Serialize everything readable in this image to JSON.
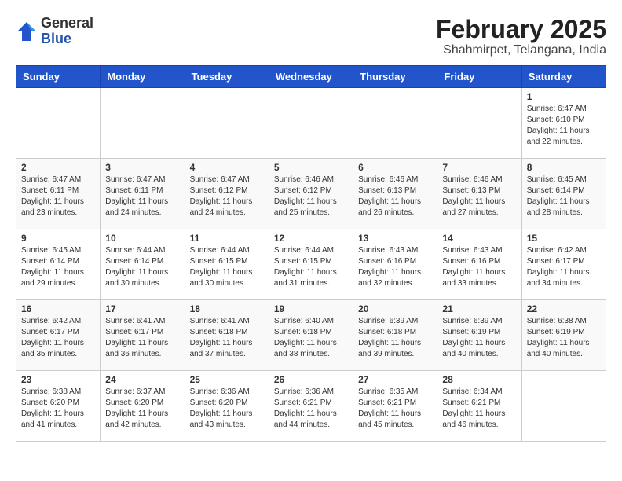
{
  "logo": {
    "general": "General",
    "blue": "Blue"
  },
  "title": "February 2025",
  "subtitle": "Shahmirpet, Telangana, India",
  "days_of_week": [
    "Sunday",
    "Monday",
    "Tuesday",
    "Wednesday",
    "Thursday",
    "Friday",
    "Saturday"
  ],
  "weeks": [
    [
      {
        "day": "",
        "detail": ""
      },
      {
        "day": "",
        "detail": ""
      },
      {
        "day": "",
        "detail": ""
      },
      {
        "day": "",
        "detail": ""
      },
      {
        "day": "",
        "detail": ""
      },
      {
        "day": "",
        "detail": ""
      },
      {
        "day": "1",
        "detail": "Sunrise: 6:47 AM\nSunset: 6:10 PM\nDaylight: 11 hours and 22 minutes."
      }
    ],
    [
      {
        "day": "2",
        "detail": "Sunrise: 6:47 AM\nSunset: 6:11 PM\nDaylight: 11 hours and 23 minutes."
      },
      {
        "day": "3",
        "detail": "Sunrise: 6:47 AM\nSunset: 6:11 PM\nDaylight: 11 hours and 24 minutes."
      },
      {
        "day": "4",
        "detail": "Sunrise: 6:47 AM\nSunset: 6:12 PM\nDaylight: 11 hours and 24 minutes."
      },
      {
        "day": "5",
        "detail": "Sunrise: 6:46 AM\nSunset: 6:12 PM\nDaylight: 11 hours and 25 minutes."
      },
      {
        "day": "6",
        "detail": "Sunrise: 6:46 AM\nSunset: 6:13 PM\nDaylight: 11 hours and 26 minutes."
      },
      {
        "day": "7",
        "detail": "Sunrise: 6:46 AM\nSunset: 6:13 PM\nDaylight: 11 hours and 27 minutes."
      },
      {
        "day": "8",
        "detail": "Sunrise: 6:45 AM\nSunset: 6:14 PM\nDaylight: 11 hours and 28 minutes."
      }
    ],
    [
      {
        "day": "9",
        "detail": "Sunrise: 6:45 AM\nSunset: 6:14 PM\nDaylight: 11 hours and 29 minutes."
      },
      {
        "day": "10",
        "detail": "Sunrise: 6:44 AM\nSunset: 6:14 PM\nDaylight: 11 hours and 30 minutes."
      },
      {
        "day": "11",
        "detail": "Sunrise: 6:44 AM\nSunset: 6:15 PM\nDaylight: 11 hours and 30 minutes."
      },
      {
        "day": "12",
        "detail": "Sunrise: 6:44 AM\nSunset: 6:15 PM\nDaylight: 11 hours and 31 minutes."
      },
      {
        "day": "13",
        "detail": "Sunrise: 6:43 AM\nSunset: 6:16 PM\nDaylight: 11 hours and 32 minutes."
      },
      {
        "day": "14",
        "detail": "Sunrise: 6:43 AM\nSunset: 6:16 PM\nDaylight: 11 hours and 33 minutes."
      },
      {
        "day": "15",
        "detail": "Sunrise: 6:42 AM\nSunset: 6:17 PM\nDaylight: 11 hours and 34 minutes."
      }
    ],
    [
      {
        "day": "16",
        "detail": "Sunrise: 6:42 AM\nSunset: 6:17 PM\nDaylight: 11 hours and 35 minutes."
      },
      {
        "day": "17",
        "detail": "Sunrise: 6:41 AM\nSunset: 6:17 PM\nDaylight: 11 hours and 36 minutes."
      },
      {
        "day": "18",
        "detail": "Sunrise: 6:41 AM\nSunset: 6:18 PM\nDaylight: 11 hours and 37 minutes."
      },
      {
        "day": "19",
        "detail": "Sunrise: 6:40 AM\nSunset: 6:18 PM\nDaylight: 11 hours and 38 minutes."
      },
      {
        "day": "20",
        "detail": "Sunrise: 6:39 AM\nSunset: 6:18 PM\nDaylight: 11 hours and 39 minutes."
      },
      {
        "day": "21",
        "detail": "Sunrise: 6:39 AM\nSunset: 6:19 PM\nDaylight: 11 hours and 40 minutes."
      },
      {
        "day": "22",
        "detail": "Sunrise: 6:38 AM\nSunset: 6:19 PM\nDaylight: 11 hours and 40 minutes."
      }
    ],
    [
      {
        "day": "23",
        "detail": "Sunrise: 6:38 AM\nSunset: 6:20 PM\nDaylight: 11 hours and 41 minutes."
      },
      {
        "day": "24",
        "detail": "Sunrise: 6:37 AM\nSunset: 6:20 PM\nDaylight: 11 hours and 42 minutes."
      },
      {
        "day": "25",
        "detail": "Sunrise: 6:36 AM\nSunset: 6:20 PM\nDaylight: 11 hours and 43 minutes."
      },
      {
        "day": "26",
        "detail": "Sunrise: 6:36 AM\nSunset: 6:21 PM\nDaylight: 11 hours and 44 minutes."
      },
      {
        "day": "27",
        "detail": "Sunrise: 6:35 AM\nSunset: 6:21 PM\nDaylight: 11 hours and 45 minutes."
      },
      {
        "day": "28",
        "detail": "Sunrise: 6:34 AM\nSunset: 6:21 PM\nDaylight: 11 hours and 46 minutes."
      },
      {
        "day": "",
        "detail": ""
      }
    ]
  ]
}
